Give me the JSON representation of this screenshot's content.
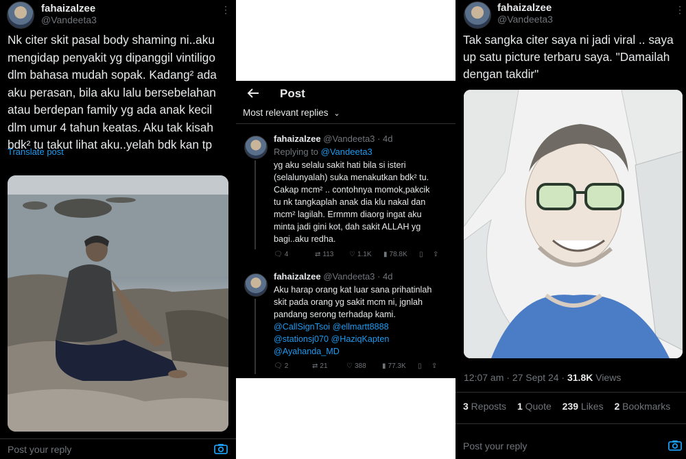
{
  "left_post": {
    "username": "fahaizalzee",
    "handle": "@Vandeeta3",
    "text": "Nk citer skit pasal body shaming ni..aku\nmengidap penyakit yg dipanggil vintiligo\ndlm bahasa mudah sopak. Kadang² ada\naku perasan, bila aku lalu bersebelahan\natau berdepan family yg ada anak kecil\ndlm umur 4 tahun keatas. Aku tak kisah\nbdk² tu takut lihat aku..yelah bdk kan tp",
    "translate": "Translate post",
    "reply_placeholder": "Post your reply"
  },
  "middle": {
    "title": "Post",
    "sort_label": "Most relevant replies",
    "replies": [
      {
        "username": "fahaizalzee",
        "handle": "@Vandeeta3",
        "time": "· 4d",
        "replying_prefix": "Replying to ",
        "replying_to": "@Vandeeta3",
        "text": "yg aku selalu sakit hati bila si isteri\n(selalunyalah) suka menakutkan bdk² tu.\nCakap mcm² .. contohnya momok,pakcik\ntu nk tangkaplah anak dia klu nakal dan\nmcm² lagilah. Ermmm diaorg ingat aku\nminta jadi gini kot, dah sakit ALLAH yg\nbagi..aku redha.",
        "replies": "4",
        "reposts": "113",
        "likes": "1.1K",
        "views": "78.8K"
      },
      {
        "username": "fahaizalzee",
        "handle": "@Vandeeta3",
        "time": "· 4d",
        "text": "Aku harap orang kat luar sana prihatinlah\nskit pada orang yg sakit mcm ni, jgnlah\npandang serong terhadap kami.",
        "mentions": [
          "@CallSignTsoi @ellmartt8888",
          "@stationsj070 @HaziqKapten",
          "@Ayahanda_MD"
        ],
        "replies": "2",
        "reposts": "21",
        "likes": "388",
        "views": "77.3K"
      }
    ]
  },
  "right_post": {
    "username": "fahaizalzee",
    "handle": "@Vandeeta3",
    "text": "Tak sangka citer saya ni jadi viral .. saya\nup satu picture terbaru saya. \"Damailah\ndengan takdir\"",
    "timestamp": "12:07 am · 27 Sept 24 · ",
    "views_count": "31.8K",
    "views_label": " Views",
    "reposts_count": "3",
    "reposts_label": " Reposts",
    "quotes_count": "1",
    "quotes_label": " Quote",
    "likes_count": "239",
    "likes_label": " Likes",
    "bookmarks_count": "2",
    "bookmarks_label": " Bookmarks",
    "reply_placeholder": "Post your reply"
  },
  "colors": {
    "accent": "#1d9bf0",
    "muted": "#71767b",
    "text": "#e7e9ea",
    "bg": "#000000"
  }
}
